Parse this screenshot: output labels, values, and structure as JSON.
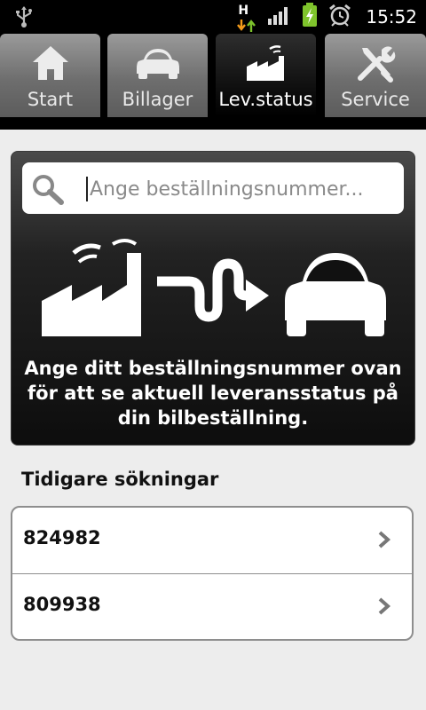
{
  "status_bar": {
    "time": "15:52",
    "network_label": "H",
    "icons": [
      "usb-icon",
      "hspa-icon",
      "signal-icon",
      "battery-charging-icon",
      "alarm-icon"
    ]
  },
  "tabs": [
    {
      "label": "Start",
      "icon": "home-icon",
      "selected": false
    },
    {
      "label": "Billager",
      "icon": "car-icon",
      "selected": false
    },
    {
      "label": "Lev.status",
      "icon": "factory-icon",
      "selected": true
    },
    {
      "label": "Service",
      "icon": "tools-icon",
      "selected": false
    }
  ],
  "search": {
    "placeholder": "Ange beställningsnummer...",
    "value": ""
  },
  "panel": {
    "description": "Ange ditt beställningsnummer ovan för att se aktuell leveransstatus på din bilbeställning.",
    "illustration_icons": [
      "factory-icon",
      "winding-arrow-icon",
      "car-front-icon"
    ]
  },
  "history": {
    "title": "Tidigare sökningar",
    "items": [
      {
        "number": "824982"
      },
      {
        "number": "809938"
      }
    ]
  },
  "colors": {
    "tab_selected": "#000000",
    "tab_unselected": "#7a7a7a",
    "panel_bg": "#1a1a1a",
    "page_bg": "#ededed"
  }
}
